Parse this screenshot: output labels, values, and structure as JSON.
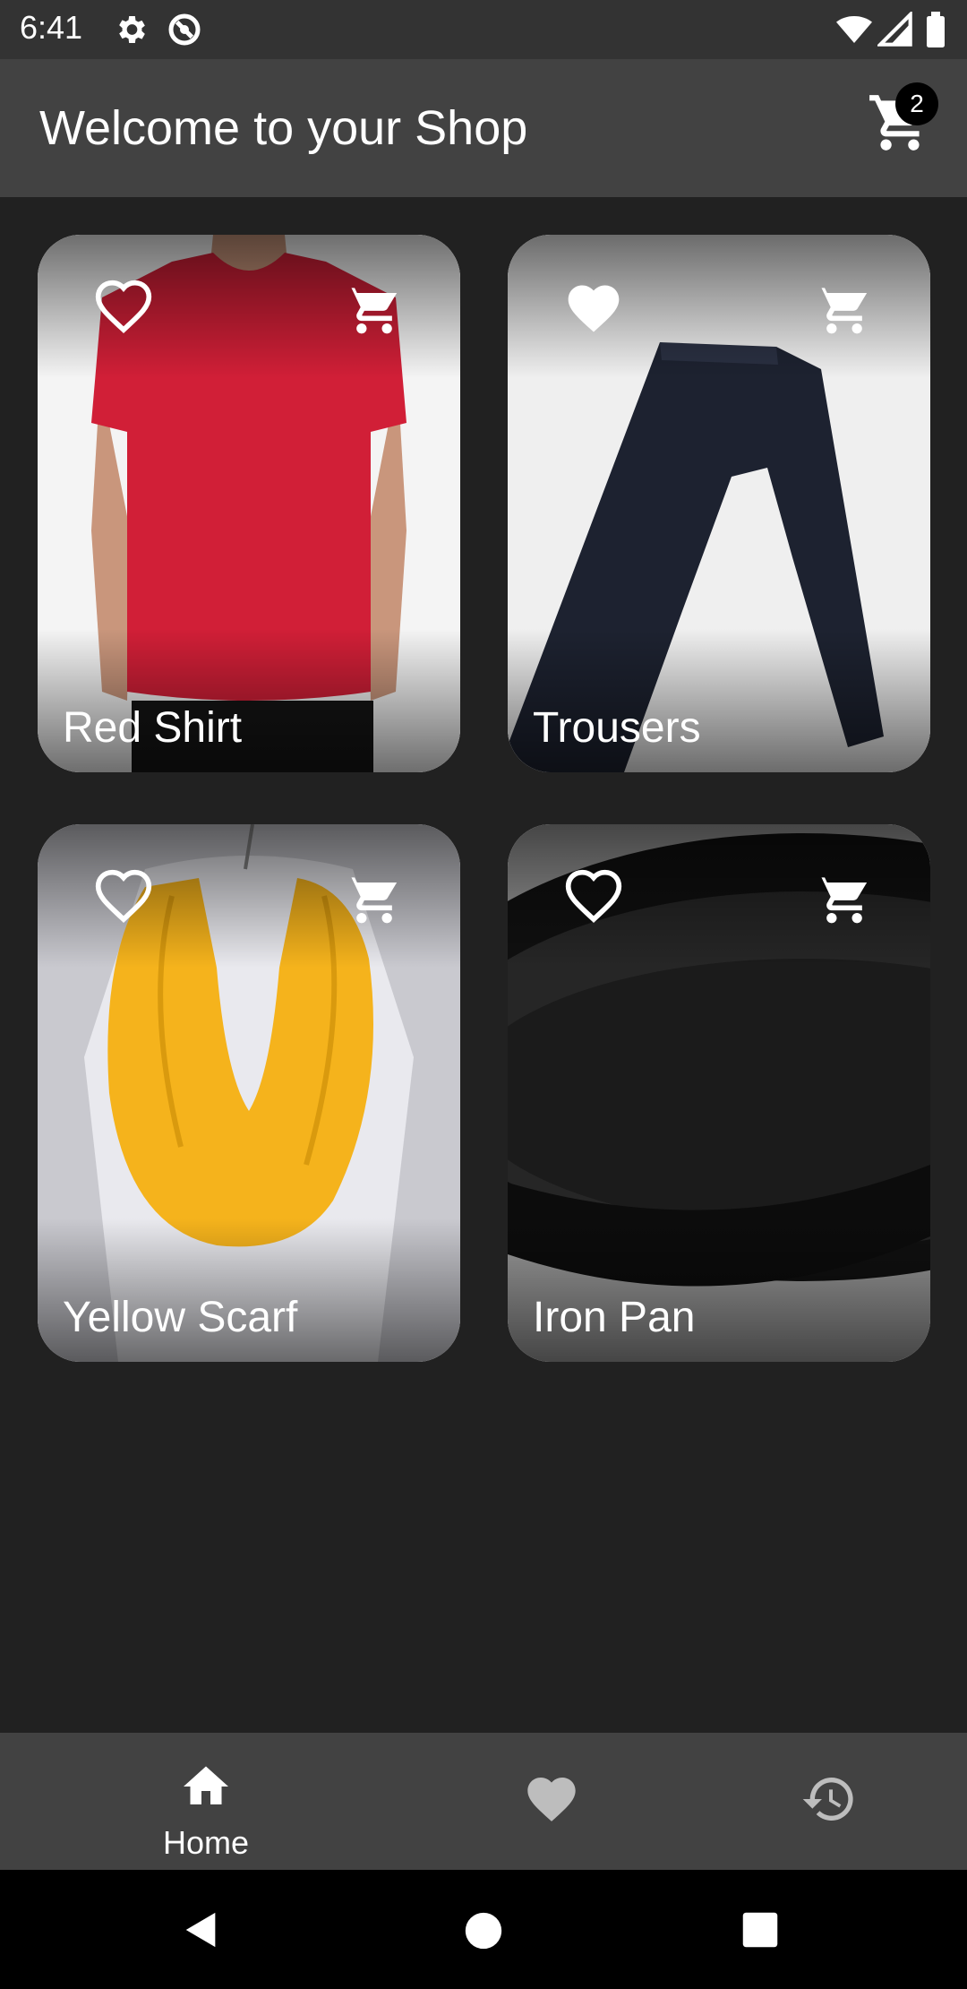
{
  "status_bar": {
    "time": "6:41",
    "icons": [
      "settings-icon",
      "vpn-icon",
      "wifi-icon",
      "signal-icon",
      "battery-icon"
    ]
  },
  "app_bar": {
    "title": "Welcome to your Shop",
    "cart_icon": "cart-icon",
    "cart_count": "2"
  },
  "products": [
    {
      "name": "Red Shirt",
      "favorite": false,
      "image": "red t-shirt"
    },
    {
      "name": "Trousers",
      "favorite": true,
      "image": "dark trousers"
    },
    {
      "name": "Yellow Scarf",
      "favorite": false,
      "image": "yellow scarf"
    },
    {
      "name": "Iron Pan",
      "favorite": false,
      "image": "cast iron pan"
    }
  ],
  "bottom_nav": {
    "items": [
      {
        "label": "Home",
        "icon": "home-icon",
        "selected": true
      },
      {
        "label": "",
        "icon": "heart-icon",
        "selected": false
      },
      {
        "label": "",
        "icon": "history-icon",
        "selected": false
      }
    ]
  },
  "system_nav": [
    "back-icon",
    "home-circle-icon",
    "recents-icon"
  ],
  "colors": {
    "background": "#212121",
    "app_bar": "#424242",
    "status_bar": "#333333",
    "accent": "#ffffff"
  }
}
